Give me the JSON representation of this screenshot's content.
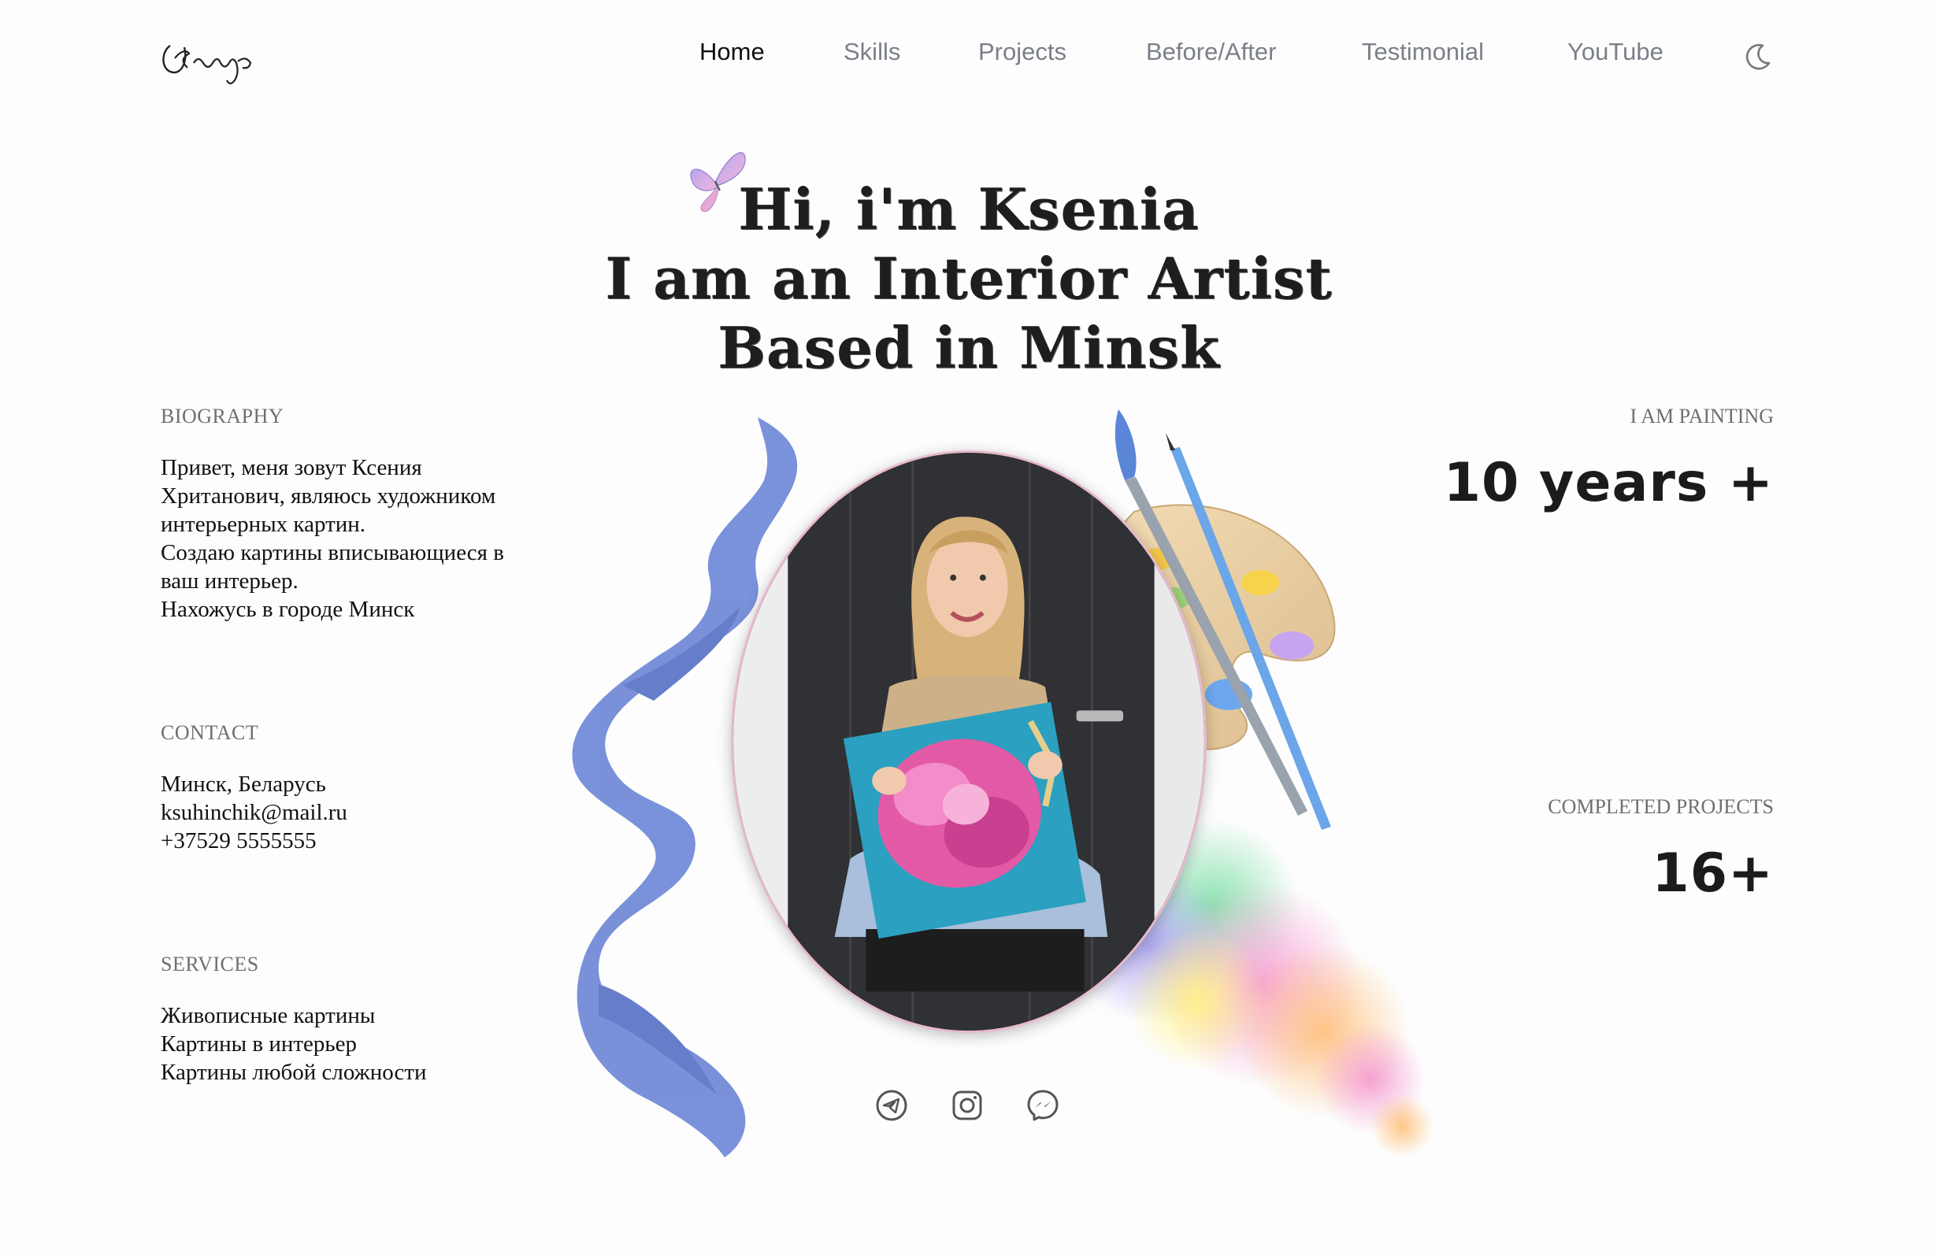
{
  "brand": {
    "logo_text": "Kseniya"
  },
  "nav": {
    "items": [
      {
        "label": "Home",
        "active": true
      },
      {
        "label": "Skills",
        "active": false
      },
      {
        "label": "Projects",
        "active": false
      },
      {
        "label": "Before/After",
        "active": false
      },
      {
        "label": "Testimonial",
        "active": false
      },
      {
        "label": "YouTube",
        "active": false
      }
    ],
    "theme_icon": "moon-icon"
  },
  "hero": {
    "line1": "Hi, i'm Ksenia",
    "line2": "I am an Interior Artist",
    "line3": "Based in Minsk"
  },
  "biography": {
    "label": "BIOGRAPHY",
    "lines": [
      "Привет, меня зовут Ксения",
      "Хританович, являюсь художником",
      "интерьерных картин.",
      "Создаю картины вписывающиеся в",
      "ваш интерьер.",
      "Нахожусь в городе Минск"
    ]
  },
  "contact": {
    "label": "CONTACT",
    "lines": [
      "Минск, Беларусь",
      "ksuhinchik@mail.ru",
      "+37529 5555555"
    ]
  },
  "services": {
    "label": "SERVICES",
    "lines": [
      "Живописные картины",
      "Картины в интерьер",
      "Картины любой сложности"
    ]
  },
  "stats": {
    "painting_label": "I AM PAINTING",
    "painting_value": "10 years +",
    "projects_label": "COMPLETED PROJECTS",
    "projects_value": "16+"
  },
  "social": [
    "telegram-icon",
    "instagram-icon",
    "messenger-icon"
  ],
  "colors": {
    "text": "#111111",
    "muted": "#7b7f88",
    "accent_blue": "#6b86d6",
    "portrait_border": "#e8b9cc"
  }
}
